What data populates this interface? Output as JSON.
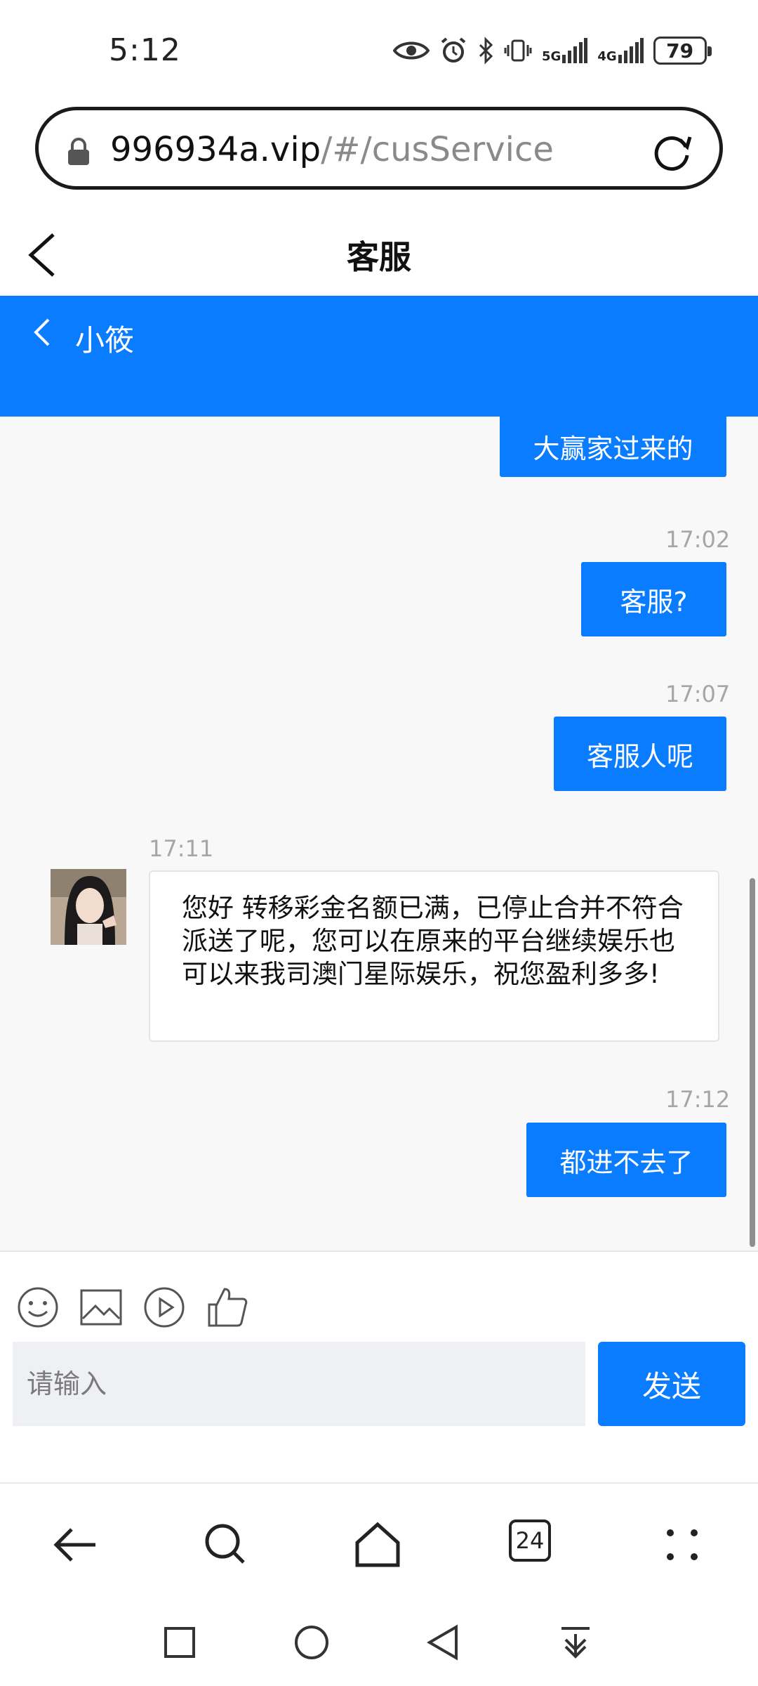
{
  "status_bar": {
    "time": "5:12",
    "network_1": "5G",
    "network_2": "4G",
    "battery": "79"
  },
  "url_bar": {
    "domain": "996934a.vip",
    "path": "/#/cusService"
  },
  "page_header": {
    "title": "客服"
  },
  "chat_header": {
    "agent_name": "小筱"
  },
  "messages": [
    {
      "direction": "out",
      "time": "",
      "text": "大赢家过来的"
    },
    {
      "direction": "out",
      "time": "17:02",
      "text": "客服?"
    },
    {
      "direction": "out",
      "time": "17:07",
      "text": "客服人呢"
    },
    {
      "direction": "in",
      "time": "17:11",
      "text": "您好 转移彩金名额已满，已停止合并不符合派送了呢，您可以在原来的平台继续娱乐也可以来我司澳门星际娱乐，祝您盈利多多!"
    },
    {
      "direction": "out",
      "time": "17:12",
      "text": "都进不去了"
    }
  ],
  "input": {
    "placeholder": "请输入",
    "send_label": "发送"
  },
  "browser_nav": {
    "tab_count": "24"
  },
  "colors": {
    "accent": "#0a7cff",
    "chat_bg": "#f8f8f8",
    "time_gray": "#a6a6a6"
  }
}
